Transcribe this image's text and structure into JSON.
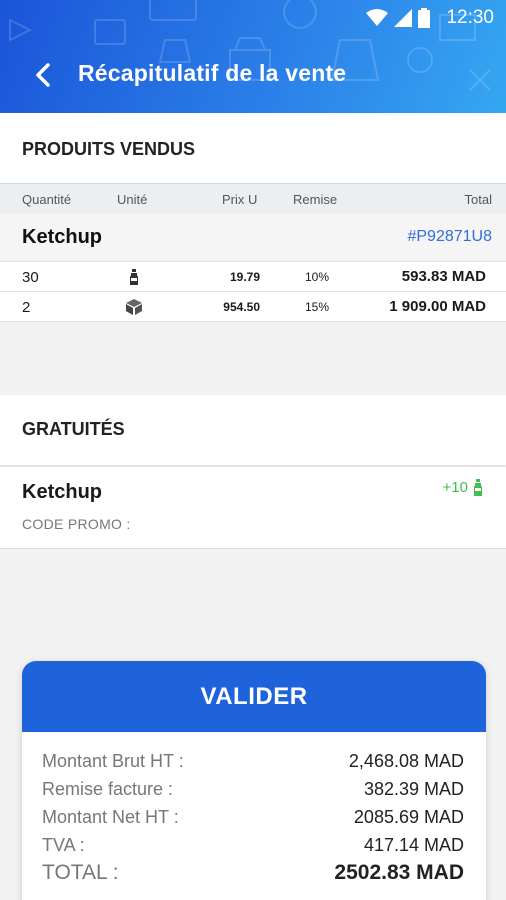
{
  "status": {
    "time": "12:30"
  },
  "header": {
    "title": "Récapitulatif de la vente"
  },
  "products_section": {
    "title": "PRODUITS VENDUS",
    "columns": [
      "Quantité",
      "Unité",
      "Prix U",
      "Remise",
      "Total"
    ],
    "product": {
      "name": "Ketchup",
      "code": "#P92871U8"
    },
    "lines": [
      {
        "qty": "30",
        "unit_icon": "bottle-icon",
        "price": "19.79",
        "discount": "10%",
        "total": "593.83 MAD"
      },
      {
        "qty": "2",
        "unit_icon": "box-icon",
        "price": "954.50",
        "discount": "15%",
        "total": "1 909.00 MAD"
      }
    ]
  },
  "gifts_section": {
    "title": "GRATUITÉS",
    "item": {
      "name": "Ketchup",
      "promo_label": "CODE PROMO :",
      "qty": "+10",
      "unit_icon": "bottle-icon"
    }
  },
  "summary": {
    "validate_label": "VALIDER",
    "rows": [
      {
        "label": "Montant Brut HT :",
        "value": "2,468.08 MAD"
      },
      {
        "label": "Remise facture :",
        "value": "382.39 MAD"
      },
      {
        "label": "Montant Net HT :",
        "value": "2085.69 MAD"
      },
      {
        "label": "TVA :",
        "value": "417.14 MAD"
      },
      {
        "label": "TOTAL :",
        "value": "2502.83 MAD"
      }
    ]
  },
  "colors": {
    "appbar": "#1f63dc",
    "accent_green": "#3fbf50",
    "code_blue": "#2f6fd6"
  }
}
